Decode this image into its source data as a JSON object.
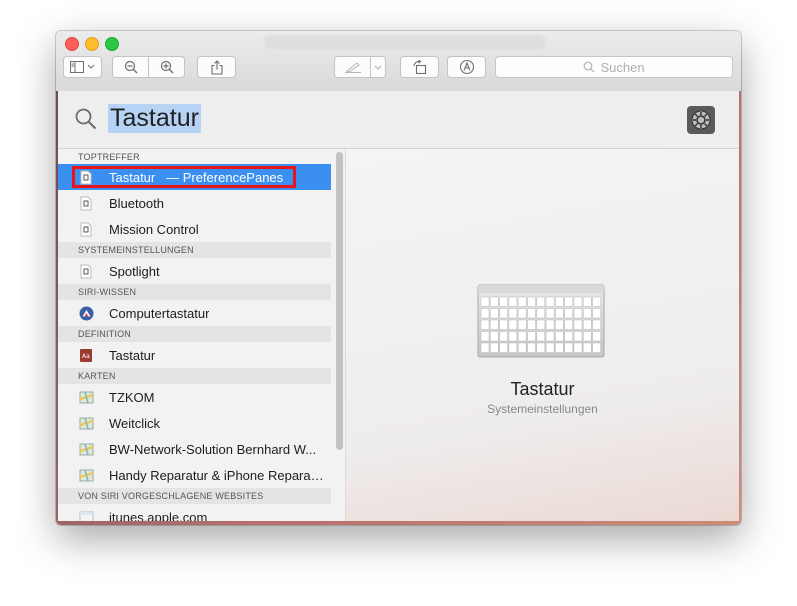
{
  "toolbar": {
    "search_placeholder": "Suchen",
    "buttons": [
      "sidebar-toggle",
      "zoom-out",
      "zoom-in",
      "share",
      "markup",
      "rotate",
      "annotate"
    ]
  },
  "spotlight": {
    "query": "Tastatur",
    "categories": {
      "toptreffer": "TOPTREFFER",
      "systemeinstellungen": "SYSTEMEINSTELLUNGEN",
      "siri_wissen": "SIRI-WISSEN",
      "definition": "DEFINITION",
      "karten": "KARTEN",
      "websites": "VON SIRI VORGESCHLAGENE WEBSITES"
    },
    "results": {
      "tastatur": "Tastatur",
      "tastatur_sub": "— PreferencePanes",
      "bluetooth": "Bluetooth",
      "mission_control": "Mission Control",
      "spotlight": "Spotlight",
      "computertastatur": "Computertastatur",
      "definition_tastatur": "Tastatur",
      "tzkom": "TZKOM",
      "weitclick": "Weitclick",
      "bw_network": "BW-Network-Solution Bernhard W...",
      "handy": "Handy Reparatur & iPhone Reparat...",
      "itunes": "itunes.apple.com"
    },
    "preview": {
      "title": "Tastatur",
      "subtitle": "Systemeinstellungen"
    }
  },
  "colors": {
    "selection": "#3a8ff0",
    "highlight_box": "#e8141c",
    "query_highlight": "#b6d3f5"
  }
}
